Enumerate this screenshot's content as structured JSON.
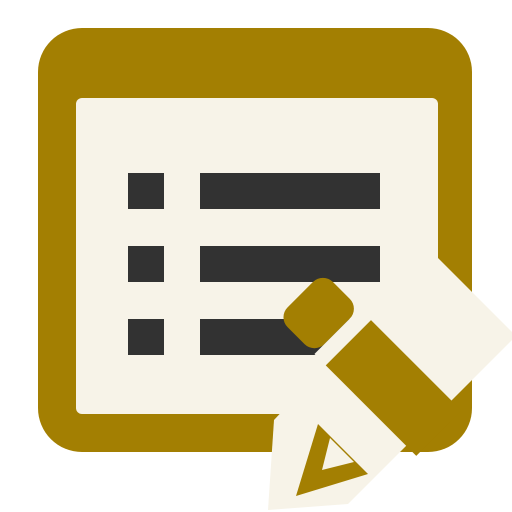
{
  "icon": {
    "name": "edit-list-icon",
    "colors": {
      "frame": "#a37f02",
      "paper": "#f7f3e8",
      "ink": "#323232",
      "pencil_body": "#a37f02",
      "pencil_ferrule": "#f7f3e8",
      "pencil_tip": "#f7f3e8"
    },
    "list_rows": 3
  }
}
